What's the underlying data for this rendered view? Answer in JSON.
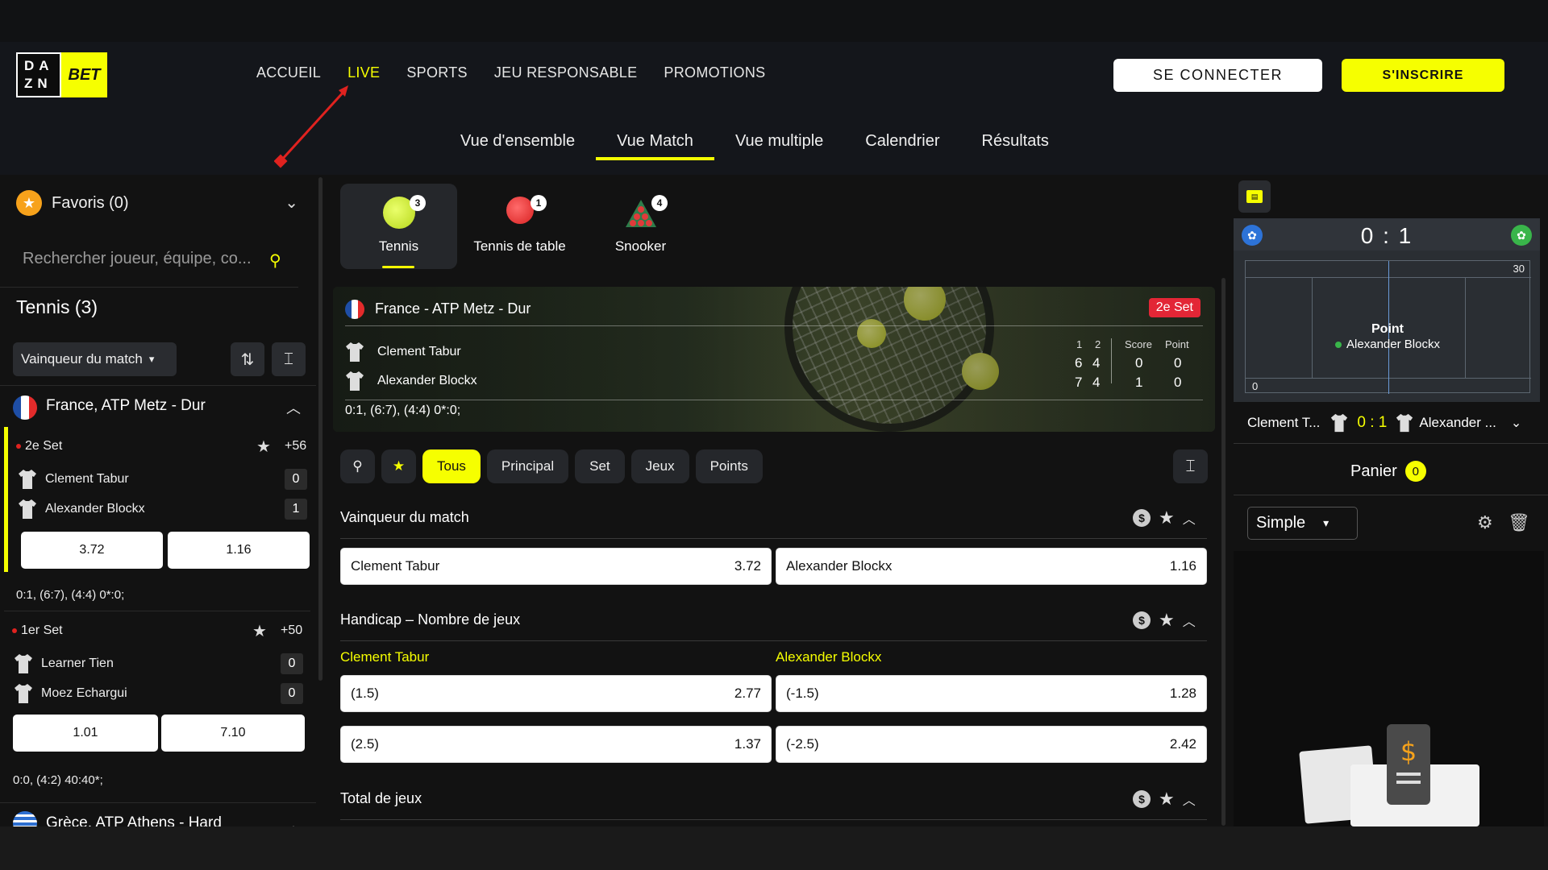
{
  "header": {
    "logo_left": "DA ZN",
    "logo_right": "BET",
    "nav": [
      "ACCUEIL",
      "LIVE",
      "SPORTS",
      "JEU RESPONSABLE",
      "PROMOTIONS"
    ],
    "connect_label": "SE CONNECTER",
    "register_label": "S'INSCRIRE"
  },
  "subnav": [
    "Vue d'ensemble",
    "Vue Match",
    "Vue multiple",
    "Calendrier",
    "Résultats"
  ],
  "sidebar": {
    "favorites_label": "Favoris (0)",
    "search_placeholder": "Rechercher joueur, équipe, co...",
    "section_title": "Tennis (3)",
    "filter_label": "Vainqueur du match",
    "league1": "France, ATP Metz - Dur",
    "league2": "Grèce, ATP Athens - Hard",
    "match1": {
      "set": "2e Set",
      "more": "+56",
      "p1": "Clement Tabur",
      "p2": "Alexander Blockx",
      "s1": "0",
      "s2": "1",
      "odd1": "3.72",
      "odd2": "1.16",
      "detail": "0:1, (6:7), (4:4) 0*:0;"
    },
    "match2": {
      "set": "1er Set",
      "more": "+50",
      "p1": "Learner Tien",
      "p2": "Moez Echargui",
      "s1": "0",
      "s2": "0",
      "odd1": "1.01",
      "odd2": "7.10",
      "detail": "0:0, (4:2) 40:40*;"
    }
  },
  "sports": [
    {
      "label": "Tennis",
      "count": "3"
    },
    {
      "label": "Tennis de table",
      "count": "1"
    },
    {
      "label": "Snooker",
      "count": "4"
    }
  ],
  "banner": {
    "title": "France - ATP Metz - Dur",
    "set_badge": "2e Set",
    "p1": "Clement Tabur",
    "p2": "Alexander Blockx",
    "h1": "1",
    "h2": "2",
    "h_score": "Score",
    "h_point": "Point",
    "p1_set1": "6",
    "p1_set2": "4",
    "p1_score": "0",
    "p1_point": "0",
    "p2_set1": "7",
    "p2_set2": "4",
    "p2_score": "1",
    "p2_point": "0",
    "summary": "0:1, (6:7), (4:4) 0*:0;"
  },
  "chips": [
    "Tous",
    "Principal",
    "Set",
    "Jeux",
    "Points"
  ],
  "markets": {
    "winner": {
      "title": "Vainqueur du match",
      "bet1_name": "Clement Tabur",
      "bet1_odd": "3.72",
      "bet2_name": "Alexander Blockx",
      "bet2_odd": "1.16"
    },
    "handicap": {
      "title": "Handicap – Nombre de jeux",
      "col1": "Clement Tabur",
      "col2": "Alexander Blockx",
      "rows": [
        {
          "a_label": "(1.5)",
          "a_odd": "2.77",
          "b_label": "(-1.5)",
          "b_odd": "1.28"
        },
        {
          "a_label": "(2.5)",
          "a_odd": "1.37",
          "b_label": "(-2.5)",
          "b_odd": "2.42"
        }
      ]
    },
    "total": {
      "title": "Total de jeux"
    }
  },
  "right_panel": {
    "court_score": "0 : 1",
    "court_top_num": "30",
    "court_bottom_num": "0",
    "point_title": "Point",
    "point_player": "Alexander Blockx",
    "mini_p1": "Clement T...",
    "mini_score": "0 : 1",
    "mini_p2": "Alexander ...",
    "panier_label": "Panier",
    "panier_count": "0",
    "bet_type": "Simple"
  },
  "colors": {
    "accent": "#f6ff00",
    "live_badge": "#e32636",
    "bg": "#121212"
  }
}
